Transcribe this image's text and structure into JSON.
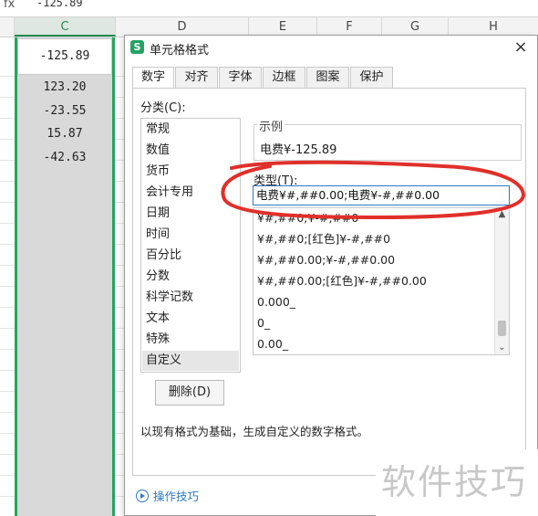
{
  "formula_bar": {
    "fx": "fx",
    "value": "-125.89"
  },
  "columns": [
    {
      "letter": "C",
      "selected": true
    },
    {
      "letter": "D"
    },
    {
      "letter": "E"
    },
    {
      "letter": "F"
    },
    {
      "letter": "G"
    },
    {
      "letter": "H"
    }
  ],
  "cells": {
    "active": "-125.89",
    "values": [
      "123.20",
      "-23.55",
      "15.87",
      "-42.63"
    ]
  },
  "dialog": {
    "title": "单元格格式",
    "app_icon_letter": "S",
    "close_label": "×",
    "tabs": [
      {
        "label": "数字",
        "active": true
      },
      {
        "label": "对齐"
      },
      {
        "label": "字体"
      },
      {
        "label": "边框"
      },
      {
        "label": "图案"
      },
      {
        "label": "保护"
      }
    ],
    "category_label": "分类(C):",
    "categories": [
      {
        "label": "常规"
      },
      {
        "label": "数值"
      },
      {
        "label": "货币"
      },
      {
        "label": "会计专用"
      },
      {
        "label": "日期"
      },
      {
        "label": "时间"
      },
      {
        "label": "百分比"
      },
      {
        "label": "分数"
      },
      {
        "label": "科学记数"
      },
      {
        "label": "文本"
      },
      {
        "label": "特殊"
      },
      {
        "label": "自定义",
        "selected": true
      }
    ],
    "sample": {
      "legend": "示例",
      "value": "电费¥-125.89"
    },
    "type_label": "类型(T):",
    "type_input": "电费¥#,##0.00;电费¥-#,##0.00",
    "type_options": [
      "¥#,##0;¥-#,##0",
      "¥#,##0;[红色]¥-#,##0",
      "¥#,##0.00;¥-#,##0.00",
      "¥#,##0.00;[红色]¥-#,##0.00",
      "0.000_",
      "0_",
      "0.00_"
    ],
    "delete_button": "删除(D)",
    "hint": "以现有格式为基础，生成自定义的数字格式。",
    "footer_link": "操作技巧"
  },
  "watermark": "软件技巧",
  "colors": {
    "accent_green": "#27a35d",
    "annotation_red": "#e0302a",
    "link_blue": "#2f78c4"
  }
}
